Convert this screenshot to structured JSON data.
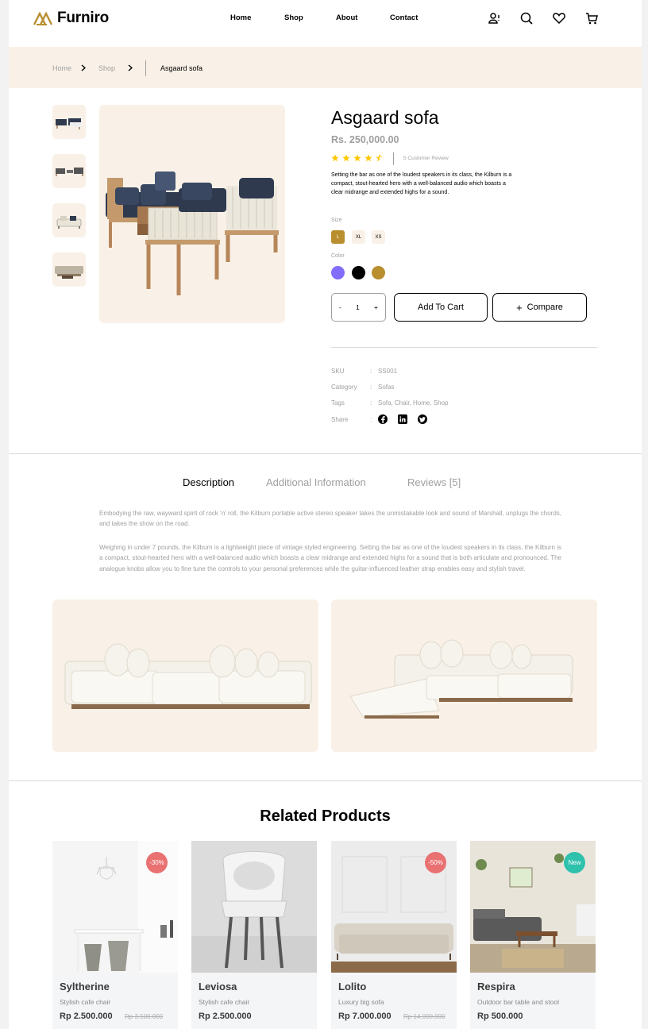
{
  "brand": {
    "name": "Furniro",
    "accent": "#b88e2f"
  },
  "nav": {
    "home": "Home",
    "shop": "Shop",
    "about": "About",
    "contact": "Contact"
  },
  "header_icons": [
    "account-icon",
    "search-icon",
    "heart-icon",
    "cart-icon"
  ],
  "breadcrumb": {
    "home": "Home",
    "shop": "Shop",
    "current": "Asgaard sofa"
  },
  "product": {
    "name": "Asgaard sofa",
    "price": "Rs. 250,000.00",
    "rating": 4.5,
    "review_text": "5 Customer Review",
    "description": "Setting the bar as one of the loudest speakers in its class, the Kilburn is a compact, stout-hearted hero with a well-balanced audio which boasts a clear midrange and extended highs for a sound.",
    "size_label": "Size",
    "sizes": [
      "L",
      "XL",
      "XS"
    ],
    "selected_size": "L",
    "color_label": "Color",
    "colors": [
      "#816dfa",
      "#000000",
      "#b88e2f"
    ],
    "qty_minus": "-",
    "qty_value": "1",
    "qty_plus": "+",
    "add_to_cart": "Add To Cart",
    "compare_icon": "+",
    "compare": "Compare",
    "meta": {
      "sku_label": "SKU",
      "sku": "SS001",
      "category_label": "Category",
      "category": "Sofas",
      "tags_label": "Tags",
      "tags": "Sofa, Chair, Home, Shop",
      "share_label": "Share",
      "colon": ":"
    }
  },
  "tabs": {
    "description": "Description",
    "additional": "Additional Information",
    "reviews": "Reviews [5]"
  },
  "long_description": {
    "p1": "Embodying the raw, wayward spirit of rock ‘n’ roll, the Kilburn portable active stereo speaker takes the unmistakable look and sound of Marshall, unplugs the chords, and takes the show on the road.",
    "p2": "Weighing in under 7 pounds, the Kilburn is a lightweight piece of vintage styled engineering. Setting the bar as one of the loudest speakers in its class, the Kilburn is a compact, stout-hearted hero with a well-balanced audio which boasts a clear midrange and extended highs for a sound that is both articulate and pronounced. The analogue knobs allow you to fine tune the controls to your personal preferences while the guitar-influenced leather strap enables easy and stylish travel."
  },
  "related": {
    "title": "Related Products",
    "items": [
      {
        "name": "Syltherine",
        "desc": "Stylish cafe chair",
        "price": "Rp 2.500.000",
        "old_price": "Rp 3.500.000",
        "badge": "-30%",
        "badge_color": "#e97171"
      },
      {
        "name": "Leviosa",
        "desc": "Stylish cafe chair",
        "price": "Rp 2.500.000",
        "old_price": "",
        "badge": "",
        "badge_color": ""
      },
      {
        "name": "Lolito",
        "desc": "Luxury big sofa",
        "price": "Rp 7.000.000",
        "old_price": "Rp 14.000.000",
        "badge": "-50%",
        "badge_color": "#e97171"
      },
      {
        "name": "Respira",
        "desc": "Outdoor bar table and stool",
        "price": "Rp 500.000",
        "old_price": "",
        "badge": "New",
        "badge_color": "#2ec1ac"
      }
    ]
  }
}
